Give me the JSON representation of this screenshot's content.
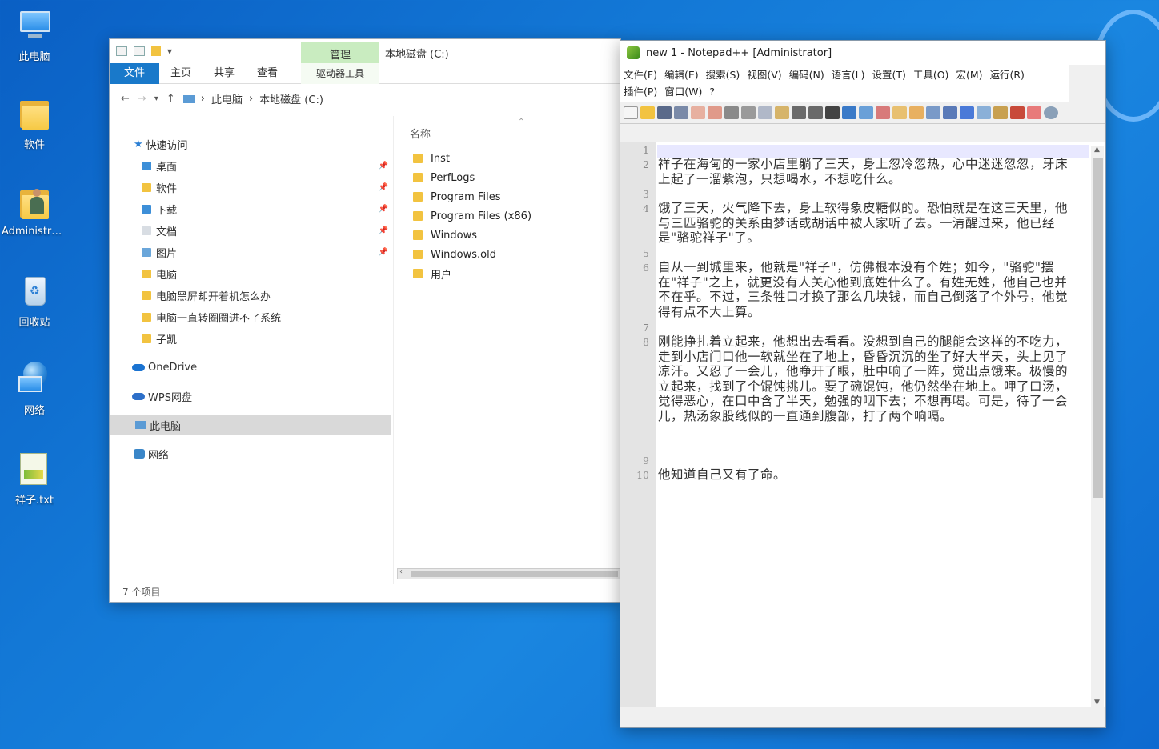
{
  "desktop": {
    "icons": [
      {
        "label": "此电脑"
      },
      {
        "label": "软件"
      },
      {
        "label": "Administra..."
      },
      {
        "label": "回收站"
      },
      {
        "label": "网络"
      },
      {
        "label": "祥子.txt"
      }
    ]
  },
  "explorer": {
    "ribbon_context_tab": "管理",
    "title": "本地磁盘 (C:)",
    "tabs": [
      "文件",
      "主页",
      "共享",
      "查看"
    ],
    "context_subtab": "驱动器工具",
    "breadcrumb": [
      "此电脑",
      "本地磁盘 (C:)"
    ],
    "nav": {
      "quick_access": "快速访问",
      "quick_items": [
        {
          "label": "桌面",
          "pinned": true
        },
        {
          "label": "软件",
          "pinned": true
        },
        {
          "label": "下载",
          "pinned": true
        },
        {
          "label": "文档",
          "pinned": true
        },
        {
          "label": "图片",
          "pinned": true
        },
        {
          "label": "电脑",
          "pinned": false
        },
        {
          "label": "电脑黑屏却开着机怎么办",
          "pinned": false
        },
        {
          "label": "电脑一直转圈圈进不了系统",
          "pinned": false
        },
        {
          "label": "子凯",
          "pinned": false
        }
      ],
      "onedrive": "OneDrive",
      "wps": "WPS网盘",
      "this_pc": "此电脑",
      "network": "网络"
    },
    "column_name": "名称",
    "files": [
      "Inst",
      "PerfLogs",
      "Program Files",
      "Program Files (x86)",
      "Windows",
      "Windows.old",
      "用户"
    ],
    "status": "7 个项目"
  },
  "notepad": {
    "title": "new 1 - Notepad++ [Administrator]",
    "menu": [
      "文件(F)",
      "编辑(E)",
      "搜索(S)",
      "视图(V)",
      "编码(N)",
      "语言(L)",
      "设置(T)",
      "工具(O)",
      "宏(M)",
      "运行(R)",
      "插件(P)",
      "窗口(W)",
      "?"
    ],
    "line_numbers": [
      "1",
      "2",
      "3",
      "4",
      "5",
      "6",
      "7",
      "8",
      "9",
      "10"
    ],
    "paragraphs": [
      "祥子在海甸的一家小店里躺了三天，身上忽冷忽热，心中迷迷忽忽，牙床上起了一溜紫泡，只想喝水，不想吃什么。",
      "饿了三天，火气降下去，身上软得象皮糖似的。恐怕就是在这三天里，他与三匹骆驼的关系由梦话或胡话中被人家听了去。一清醒过来，他已经是\"骆驼祥子\"了。",
      "自从一到城里来，他就是\"祥子\"，仿佛根本没有个姓；如今，\"骆驼\"摆在\"祥子\"之上，就更没有人关心他到底姓什么了。有姓无姓，他自己也并不在乎。不过，三条牲口才换了那么几块钱，而自己倒落了个外号，他觉得有点不大上算。",
      "刚能挣扎着立起来，他想出去看看。没想到自己的腿能会这样的不吃力，走到小店门口他一软就坐在了地上，昏昏沉沉的坐了好大半天，头上见了凉汗。又忍了一会儿，他睁开了眼，肚中响了一阵，觉出点饿来。极慢的立起来，找到了个馄饨挑儿。要了碗馄饨，他仍然坐在地上。呷了口汤，觉得恶心，在口中含了半天，勉强的咽下去；不想再喝。可是，待了一会儿，热汤象股线似的一直通到腹部，打了两个响嗝。",
      "他知道自己又有了命。"
    ]
  }
}
